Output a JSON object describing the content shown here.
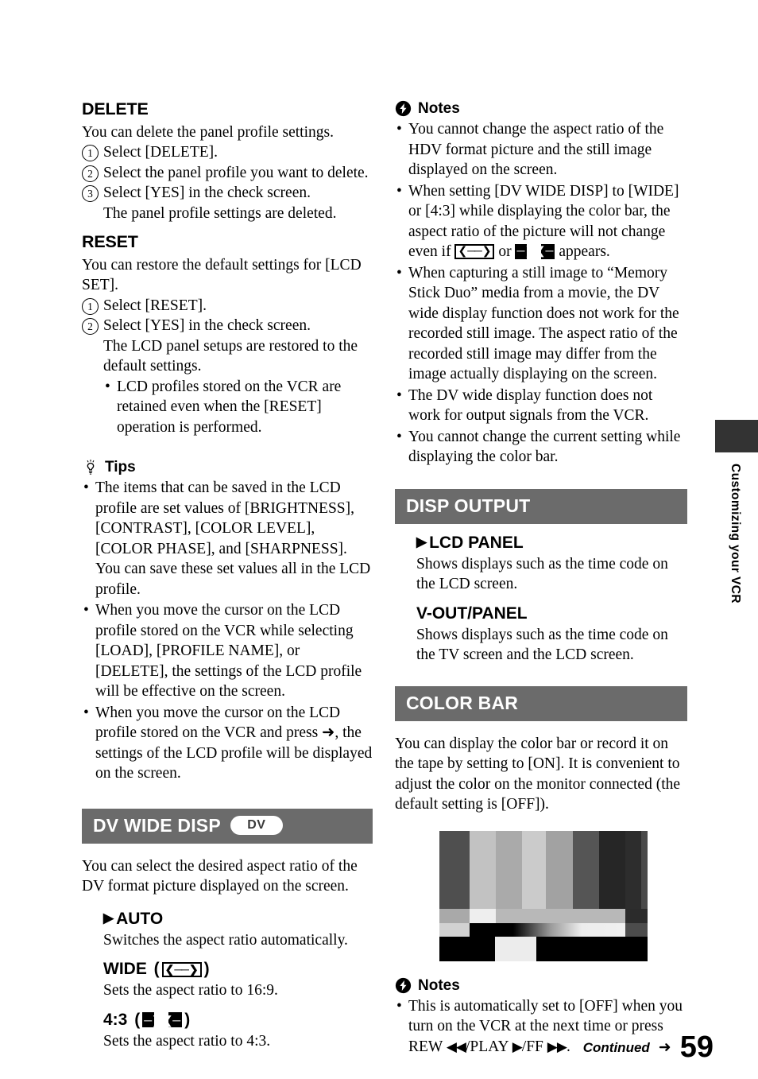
{
  "page": {
    "number": "59",
    "continued_label": "Continued",
    "continued_arrow": "➜",
    "side_tab_label": "Customizing your VCR",
    "bar_color": "#6b6b6b",
    "side_tab_block_color": "#333333"
  },
  "left_column": {
    "delete": {
      "heading": "DELETE",
      "intro": "You can delete the panel profile settings.",
      "steps": [
        {
          "num": "1",
          "text": "Select [DELETE]."
        },
        {
          "num": "2",
          "text": "Select the panel profile you want to delete."
        },
        {
          "num": "3",
          "text": "Select [YES] in the check screen.",
          "sub": "The panel profile settings are deleted."
        }
      ]
    },
    "reset": {
      "heading": "RESET",
      "intro": "You can restore the default settings for [LCD SET].",
      "steps": [
        {
          "num": "1",
          "text": "Select [RESET]."
        },
        {
          "num": "2",
          "text": "Select [YES] in the check screen.",
          "sub": "The LCD panel setups are restored to the default settings."
        }
      ],
      "bullets": [
        "LCD profiles stored on the VCR are retained even when the [RESET] operation is performed."
      ]
    },
    "tips": {
      "icon": "lightbulb-icon",
      "heading": "Tips",
      "bullets": [
        "The items that can be saved in the LCD profile are set values of [BRIGHTNESS], [CONTRAST], [COLOR LEVEL], [COLOR PHASE], and [SHARPNESS]. You can save these set values all in the LCD profile.",
        "When you move the cursor on the LCD profile stored on the VCR while selecting [LOAD], [PROFILE NAME], or [DELETE], the settings of the LCD profile will be effective on the screen.",
        "When you move the cursor on the LCD profile stored on the VCR and press ➜, the settings of the LCD profile will be displayed on the screen."
      ]
    },
    "dv_wide_disp": {
      "bar_title": "DV WIDE DISP",
      "badge": "DV",
      "intro": "You can select the desired aspect ratio of the DV format picture displayed on the screen.",
      "options": [
        {
          "marker": "▶",
          "label": "AUTO",
          "icon": "",
          "description": "Switches the aspect ratio automatically."
        },
        {
          "marker": "",
          "label": "WIDE",
          "icon": "wide-aspect-icon",
          "description": "Sets the aspect ratio to 16:9."
        },
        {
          "marker": "",
          "label": "4:3",
          "icon": "four-three-aspect-icon",
          "description": "Sets the aspect ratio to 4:3."
        }
      ]
    }
  },
  "right_column": {
    "notes_top": {
      "icon": "notes-icon",
      "heading": "Notes",
      "bullets": [
        {
          "text": "You cannot change the aspect ratio of the HDV format picture and the still image displayed on the screen."
        },
        {
          "text_before": "When setting [DV WIDE DISP] to [WIDE] or [4:3] while displaying the color bar, the aspect ratio of the picture will not change even if ",
          "inline_icon_1": "wide-aspect-icon",
          "text_middle": " or ",
          "inline_icon_2": "four-three-aspect-icon",
          "text_after": " appears."
        },
        {
          "text": "When capturing a still image to “Memory Stick Duo” media from a movie, the DV wide display function does not work for the recorded still image. The aspect ratio of the recorded still image may differ from the image actually displaying on the screen."
        },
        {
          "text": "The DV wide display function does not work for output signals from the VCR."
        },
        {
          "text": "You cannot change the current setting while displaying the color bar."
        }
      ]
    },
    "disp_output": {
      "bar_title": "DISP OUTPUT",
      "options": [
        {
          "marker": "▶",
          "label": "LCD PANEL",
          "description": "Shows displays such as the time code on the LCD screen."
        },
        {
          "marker": "",
          "label": "V-OUT/PANEL",
          "description": "Shows displays such as the time code on the TV screen and the LCD screen."
        }
      ]
    },
    "color_bar": {
      "bar_title": "COLOR BAR",
      "intro": "You can display the color bar or record it on the tape by setting to [ON]. It is convenient to adjust the color on the monitor connected (the default setting is [OFF]).",
      "figure_alt": "color-bar-test-pattern",
      "notes": {
        "icon": "notes-icon",
        "heading": "Notes",
        "bullet_before": "This is automatically set to [OFF] when you turn on the VCR at the next time or press REW ",
        "rew_icon": "◀◀",
        "bullet_mid_1": "/PLAY ",
        "play_icon": "▶",
        "bullet_mid_2": "/FF ",
        "ff_icon": "▶▶",
        "bullet_after": "."
      }
    }
  },
  "colorbar_pattern": {
    "top_row": [
      "#4f4f4f",
      "#c2c2c2",
      "#aaaaaa",
      "#cbcbcb",
      "#a2a2a2",
      "#555555",
      "#262626",
      "#2d2d2d",
      "#4a4a4a"
    ],
    "top_widths": [
      38,
      33,
      33,
      30,
      34,
      33,
      33,
      20,
      8
    ],
    "mid_row": [
      "#a9a9a9",
      "#eeeeee",
      "#b8b8b8",
      "#2b2b2b"
    ],
    "mid_widths": [
      38,
      33,
      163,
      28
    ],
    "mid2_row": [
      "#d2d2d2",
      "gradient",
      "#4c4c4c"
    ],
    "mid2_widths": [
      38,
      196,
      28
    ],
    "bottom_row": [
      "#000000",
      "#ececec",
      "#000000"
    ],
    "bottom_widths": [
      70,
      52,
      140
    ]
  }
}
